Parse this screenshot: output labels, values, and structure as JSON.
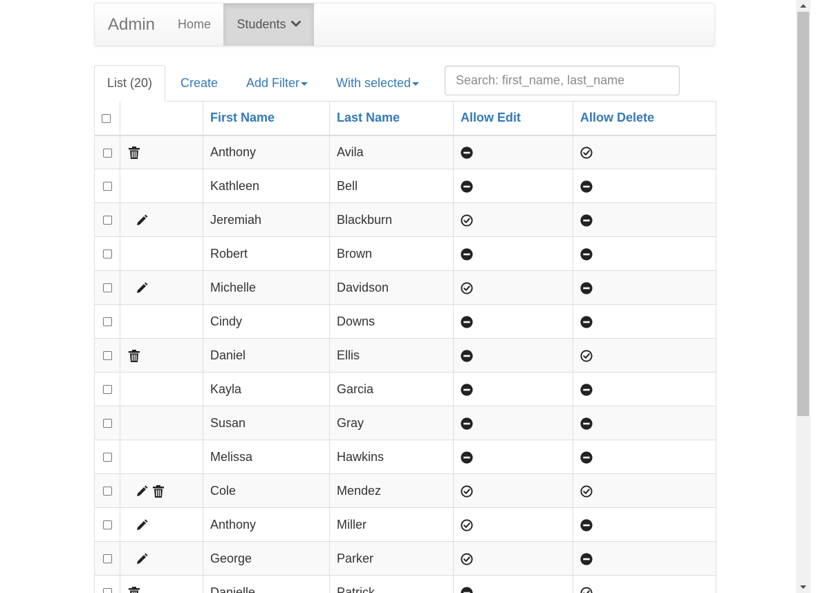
{
  "navbar": {
    "brand": "Admin",
    "links": [
      {
        "label": "Home",
        "active": false
      },
      {
        "label": "Students",
        "active": true,
        "dropdown": true
      }
    ]
  },
  "tabs": {
    "list": "List (20)",
    "create": "Create",
    "add_filter": "Add Filter",
    "with_selected": "With selected"
  },
  "search": {
    "placeholder": "Search: first_name, last_name",
    "value": ""
  },
  "table": {
    "columns": [
      "First Name",
      "Last Name",
      "Allow Edit",
      "Allow Delete"
    ],
    "rows": [
      {
        "first": "Anthony",
        "last": "Avila",
        "allow_edit": false,
        "allow_delete": true
      },
      {
        "first": "Kathleen",
        "last": "Bell",
        "allow_edit": false,
        "allow_delete": false
      },
      {
        "first": "Jeremiah",
        "last": "Blackburn",
        "allow_edit": true,
        "allow_delete": false
      },
      {
        "first": "Robert",
        "last": "Brown",
        "allow_edit": false,
        "allow_delete": false
      },
      {
        "first": "Michelle",
        "last": "Davidson",
        "allow_edit": true,
        "allow_delete": false
      },
      {
        "first": "Cindy",
        "last": "Downs",
        "allow_edit": false,
        "allow_delete": false
      },
      {
        "first": "Daniel",
        "last": "Ellis",
        "allow_edit": false,
        "allow_delete": true
      },
      {
        "first": "Kayla",
        "last": "Garcia",
        "allow_edit": false,
        "allow_delete": false
      },
      {
        "first": "Susan",
        "last": "Gray",
        "allow_edit": false,
        "allow_delete": false
      },
      {
        "first": "Melissa",
        "last": "Hawkins",
        "allow_edit": false,
        "allow_delete": false
      },
      {
        "first": "Cole",
        "last": "Mendez",
        "allow_edit": true,
        "allow_delete": true
      },
      {
        "first": "Anthony",
        "last": "Miller",
        "allow_edit": true,
        "allow_delete": false
      },
      {
        "first": "George",
        "last": "Parker",
        "allow_edit": true,
        "allow_delete": false
      },
      {
        "first": "Danielle",
        "last": "Patrick",
        "allow_edit": false,
        "allow_delete": true
      }
    ]
  },
  "icons": {
    "edit": "pencil-icon",
    "delete": "trash-icon",
    "allowed": "check-circle-icon",
    "denied": "minus-circle-icon"
  },
  "colors": {
    "link": "#337ab7",
    "active_nav_bg": "#d8d8d8",
    "border": "#dddddd",
    "stripe": "#f9f9f9"
  }
}
